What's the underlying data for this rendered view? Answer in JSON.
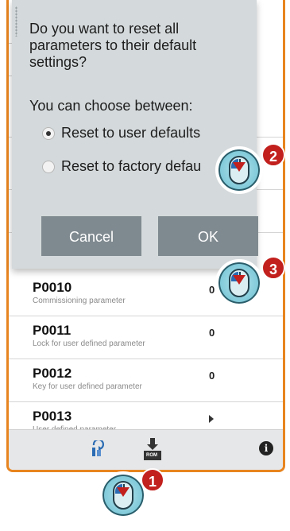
{
  "parameters": [
    {
      "id": "P0010",
      "description": "Commissioning parameter",
      "value": "0"
    },
    {
      "id": "P0011",
      "description": "Lock for user defined parameter",
      "value": "0"
    },
    {
      "id": "P0012",
      "description": "Key for user defined parameter",
      "value": "0"
    },
    {
      "id": "P0013",
      "description": "User defined parameter",
      "value": ""
    }
  ],
  "dialog": {
    "message": "Do you want to reset all parameters to their default settings?",
    "choose_label": "You can choose between:",
    "options": [
      {
        "label": "Reset to user defaults",
        "selected": true
      },
      {
        "label": "Reset to factory defau",
        "selected": false
      }
    ],
    "cancel_label": "Cancel",
    "ok_label": "OK"
  },
  "toolbar": {
    "reset_icon": "reset-parameters-icon",
    "rom_label": "ROM",
    "info_icon": "info-icon"
  },
  "steps": [
    "1",
    "2",
    "3"
  ],
  "colors": {
    "frame_border": "#e8841f",
    "dialog_bg": "#d4d9db",
    "button_bg": "#7f8a90",
    "badge_red": "#c2201d",
    "icon_blue": "#2a6bb3"
  }
}
